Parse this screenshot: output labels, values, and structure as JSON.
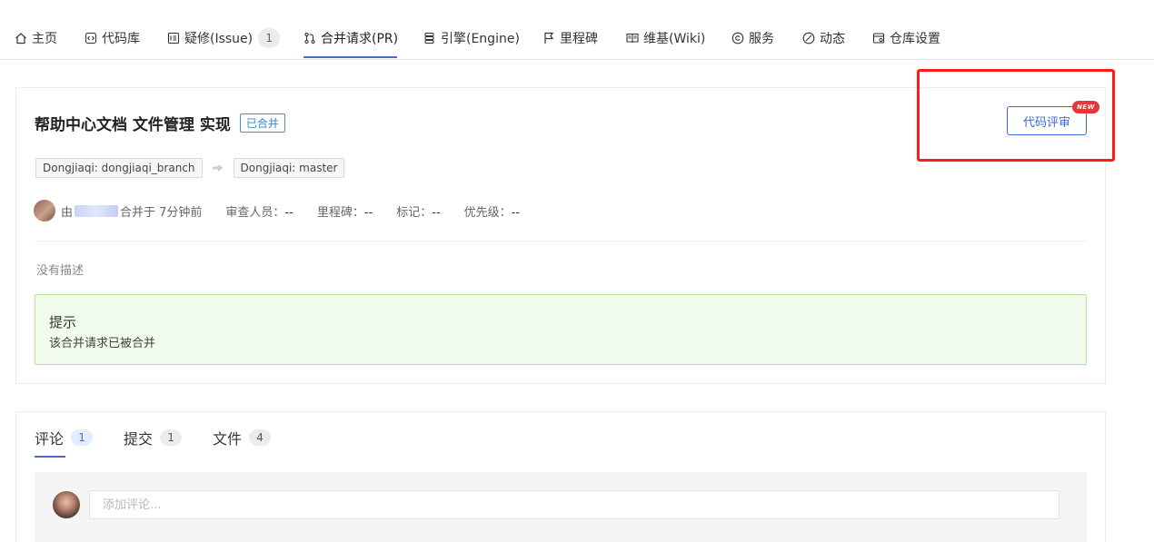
{
  "nav": {
    "items": [
      {
        "label": "主页",
        "icon": "home-icon"
      },
      {
        "label": "代码库",
        "icon": "code-icon"
      },
      {
        "label": "疑修(Issue)",
        "icon": "issue-icon",
        "badge": "1"
      },
      {
        "label": "合并请求(PR)",
        "icon": "pull-request-icon"
      },
      {
        "label": "引擎(Engine)",
        "icon": "engine-icon"
      },
      {
        "label": "里程碑",
        "icon": "flag-icon"
      },
      {
        "label": "维基(Wiki)",
        "icon": "book-icon"
      },
      {
        "label": "服务",
        "icon": "service-icon"
      },
      {
        "label": "动态",
        "icon": "activity-icon"
      },
      {
        "label": "仓库设置",
        "icon": "settings-icon"
      }
    ],
    "active_index": 3
  },
  "pr": {
    "title": "帮助中心文档 文件管理 实现",
    "status": "已合并",
    "review_button": "代码评审",
    "new_badge": "NEW",
    "source_branch": "Dongjiaqi: dongjiaqi_branch",
    "target_branch": "Dongjiaqi: master",
    "meta": {
      "by": "由",
      "merged_at": "合并于 7分钟前",
      "reviewers_label": "审查人员：",
      "reviewers_value": "--",
      "milestone_label": "里程碑：",
      "milestone_value": "--",
      "tags_label": "标记：",
      "tags_value": "--",
      "priority_label": "优先级：",
      "priority_value": "--"
    },
    "description": "没有描述",
    "tip": {
      "title": "提示",
      "text": "该合并请求已被合并"
    }
  },
  "tabs": [
    {
      "label": "评论",
      "count": "1"
    },
    {
      "label": "提交",
      "count": "1"
    },
    {
      "label": "文件",
      "count": "4"
    }
  ],
  "comment": {
    "placeholder": "添加评论..."
  },
  "colors": {
    "accent": "#466fcc",
    "highlight": "#ff1b1b",
    "tip_border": "#b3e19d",
    "tip_bg": "#f1fbec",
    "merged": "#3d86d0"
  }
}
